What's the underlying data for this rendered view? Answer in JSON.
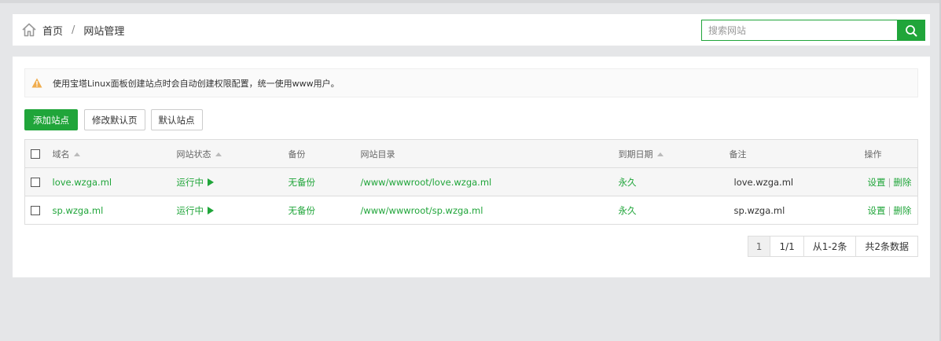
{
  "breadcrumb": {
    "home": "首页",
    "separator": "/",
    "current": "网站管理"
  },
  "search": {
    "placeholder": "搜索网站",
    "value": ""
  },
  "notice": {
    "text": "使用宝塔Linux面板创建站点时会自动创建权限配置，统一使用www用户。"
  },
  "toolbar": {
    "add_label": "添加站点",
    "modify_default_label": "修改默认页",
    "default_site_label": "默认站点"
  },
  "table": {
    "headers": {
      "domain": "域名",
      "status": "网站状态",
      "backup": "备份",
      "path": "网站目录",
      "expiry": "到期日期",
      "note": "备注",
      "actions": "操作"
    },
    "rows": [
      {
        "domain": "love.wzga.ml",
        "status": "运行中",
        "backup": "无备份",
        "path": "/www/wwwroot/love.wzga.ml",
        "expiry": "永久",
        "note": "love.wzga.ml",
        "settings": "设置",
        "delete": "删除"
      },
      {
        "domain": "sp.wzga.ml",
        "status": "运行中",
        "backup": "无备份",
        "path": "/www/wwwroot/sp.wzga.ml",
        "expiry": "永久",
        "note": "sp.wzga.ml",
        "settings": "设置",
        "delete": "删除"
      }
    ],
    "op_separator": "|"
  },
  "pagination": {
    "current": "1",
    "pages": "1/1",
    "range": "从1-2条",
    "total": "共2条数据"
  },
  "colors": {
    "accent": "#20a53a",
    "warning": "#f0ad4e"
  }
}
